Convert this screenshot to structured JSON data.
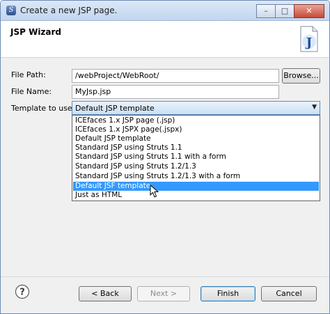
{
  "window": {
    "title": "Create a new JSP page.",
    "minimize_glyph": "–",
    "maximize_glyph": "□",
    "close_glyph": "✕"
  },
  "header": {
    "title": "JSP Wizard",
    "icon_letter": "J"
  },
  "form": {
    "file_path_label": "File Path:",
    "file_path_value": "/webProject/WebRoot/",
    "browse_label": "Browse...",
    "file_name_label": "File Name:",
    "file_name_value": "MyJsp.jsp",
    "template_label": "Template to use:",
    "template_value": "Default JSP template"
  },
  "dropdown_items": [
    "ICEfaces 1.x JSP page (.jsp)",
    "ICEfaces 1.x JSPX page(.jspx)",
    "Default JSP template",
    "Standard JSP using Struts 1.1",
    "Standard JSP using Struts 1.1 with a form",
    "Standard JSP using Struts 1.2/1.3",
    "Standard JSP using Struts 1.2/1.3 with a form",
    "Default JSF template",
    "Just as HTML"
  ],
  "highlighted_item": "Default JSF template",
  "footer": {
    "help_glyph": "?",
    "back_label": "< Back",
    "next_label": "Next >",
    "finish_label": "Finish",
    "cancel_label": "Cancel"
  },
  "colors": {
    "highlight": "#3399ff",
    "title_bar": "#c2d6ef",
    "close_button": "#c74b37"
  }
}
